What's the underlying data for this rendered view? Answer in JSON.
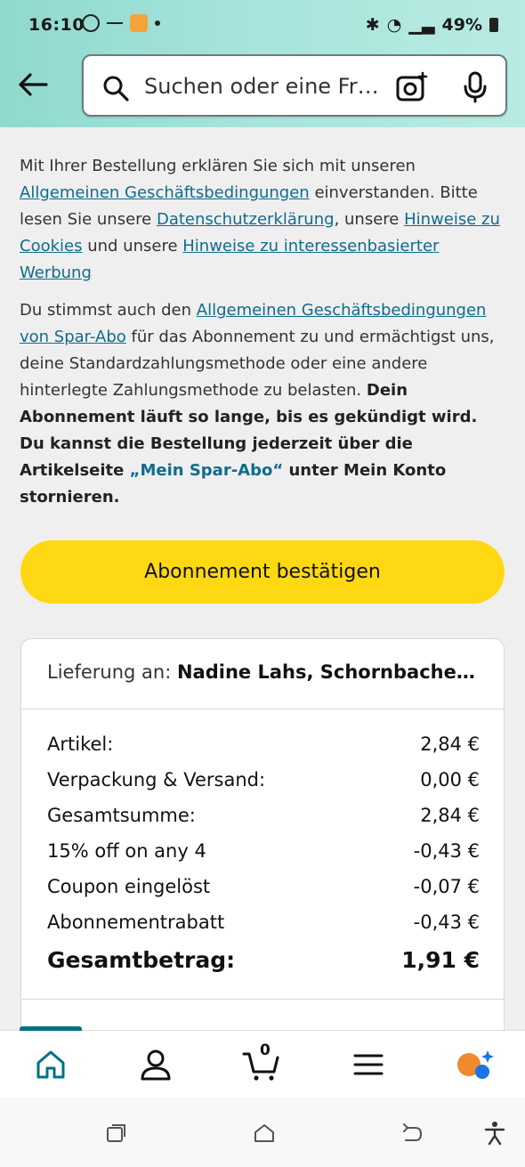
{
  "status_bar": {
    "time": "16:10",
    "battery": "49%"
  },
  "search": {
    "placeholder": "Suchen oder eine Fr…"
  },
  "legal": {
    "p1_text1": "Mit Ihrer Bestellung erklären Sie sich mit unseren ",
    "p1_link1": "Allgemeinen Geschäftsbedingungen",
    "p1_text2": " einverstanden. Bitte lesen Sie unsere ",
    "p1_link2": "Datenschutzerklärung",
    "p1_text3": ", unsere ",
    "p1_link3": "Hinweise zu Cookies",
    "p1_text4": " und unsere ",
    "p1_link4": "Hinweise zu interessenbasierter Werbung",
    "p2_text1": "Du stimmst auch den ",
    "p2_link1": "Allgemeinen Geschäftsbedingungen von Spar-Abo",
    "p2_text2": " für das Abonnement zu und ermächtigst uns, deine Standardzahlungsmethode oder eine andere hinterlegte Zahlungsmethode zu belasten. ",
    "p2_bold1": "Dein Abonnement läuft so lange, bis es gekündigt wird. Du kannst die Bestellung jederzeit über die Artikelseite ",
    "p2_bold_link": "„Mein Spar-Abo“",
    "p2_bold2": " unter Mein Konto stornieren."
  },
  "confirm_button": "Abonnement bestätigen",
  "summary": {
    "delivery_label": "Lieferung an: ",
    "delivery_name": "Nadine Lahs, Schornbache…",
    "rows": [
      {
        "label": "Artikel:",
        "value": "2,84 €"
      },
      {
        "label": "Verpackung & Versand:",
        "value": "0,00 €"
      },
      {
        "label": "Gesamtsumme:",
        "value": "2,84 €"
      },
      {
        "label": "15% off on any 4",
        "value": "-0,43 €"
      },
      {
        "label": "Coupon eingelöst",
        "value": "-0,07 €"
      },
      {
        "label": "Abonnementrabatt",
        "value": "-0,43 €"
      }
    ],
    "total_label": "Gesamtbetrag:",
    "total_value": "1,91 €"
  },
  "bottom_nav": {
    "cart_count": "0",
    "accent_color": "#007185"
  },
  "colors": {
    "button_yellow": "#ffd814",
    "link_teal": "#0f6c8b",
    "header_teal": "#a8e4dc"
  }
}
